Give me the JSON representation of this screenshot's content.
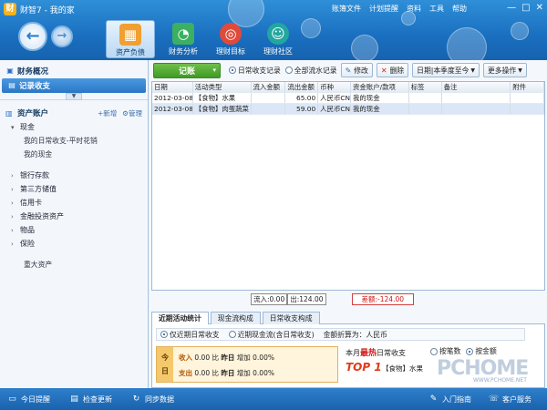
{
  "window": {
    "app_title": "财智7 - 我的家",
    "logo_char": "财",
    "menu": [
      "账簿文件",
      "计划提醒",
      "资料",
      "工具",
      "帮助"
    ],
    "controls": [
      "—",
      "□",
      "✕"
    ]
  },
  "nav": {
    "back_glyph": "←",
    "forward_glyph": "→"
  },
  "main_tabs": [
    {
      "label": "资产负债",
      "icon": "assets-icon"
    },
    {
      "label": "财务分析",
      "icon": "analysis-icon"
    },
    {
      "label": "理财目标",
      "icon": "target-icon"
    },
    {
      "label": "理财社区",
      "icon": "community-icon"
    }
  ],
  "sidebar": {
    "overview": "财务概况",
    "record": "记录收支",
    "assets_title": "资产账户",
    "add": "+新增",
    "manage": "管理",
    "cash": "现金",
    "cash_subs": [
      "我的日常收支-平时花销",
      "我的现金"
    ],
    "groups": [
      "银行存款",
      "第三方储值",
      "信用卡",
      "金融投资资产",
      "物品",
      "保险"
    ],
    "big_assets": "重大资产"
  },
  "toolbar": {
    "record": "记账",
    "radio_daily": "日常收支记录",
    "radio_all": "全部流水记录",
    "edit": "修改",
    "delete": "删除",
    "date_filter": "日期|本季度至今",
    "more": "更多操作"
  },
  "table": {
    "headers": [
      "日期",
      "活动类型",
      "流入金额",
      "流出金额",
      "币种",
      "资金账户/款项",
      "标签",
      "备注",
      "附件"
    ],
    "rows": [
      [
        "2012-03-08",
        "【食物】水果",
        "",
        "65.00",
        "人民币CNY",
        "我的现金",
        "",
        "",
        ""
      ],
      [
        "2012-03-08",
        "【食物】肉蛋蔬菜",
        "",
        "59.00",
        "人民币CNY",
        "我的现金",
        "",
        "",
        ""
      ]
    ]
  },
  "totals": {
    "in": "流入:0.00",
    "out": "出:124.00",
    "diff": "差额:-124.00"
  },
  "bottom": {
    "tabs": [
      "近期活动统计",
      "现金流构成",
      "日常收支构成"
    ],
    "radio_recent_daily": "仅近期日常收支",
    "radio_recent_cash": "近期现金流(含日常收支)",
    "currency_note": "金额折算为：人民币",
    "today_label_1": "今",
    "today_label_2": "日",
    "income_label": "收入",
    "income_value": "0.00",
    "expense_label": "支出",
    "expense_value": "0.00",
    "compare": "比",
    "yesterday": "昨日",
    "increase": "增加",
    "pct_in": "0.00%",
    "pct_out": "0.00%",
    "month_prefix": "本月",
    "month_hot": "最热",
    "month_suffix": "日常收支",
    "radio_by_count": "按笔数",
    "radio_by_amount": "按金额",
    "top1": "TOP 1",
    "top1_item": "【食物】水果"
  },
  "watermark": {
    "brand": "PCHOME",
    "url": "WWW.PCHOME.NET"
  },
  "status": {
    "reminder": "今日提醒",
    "update": "检查更新",
    "sync": "同步数据",
    "guide": "入门指南",
    "service": "客户服务"
  }
}
